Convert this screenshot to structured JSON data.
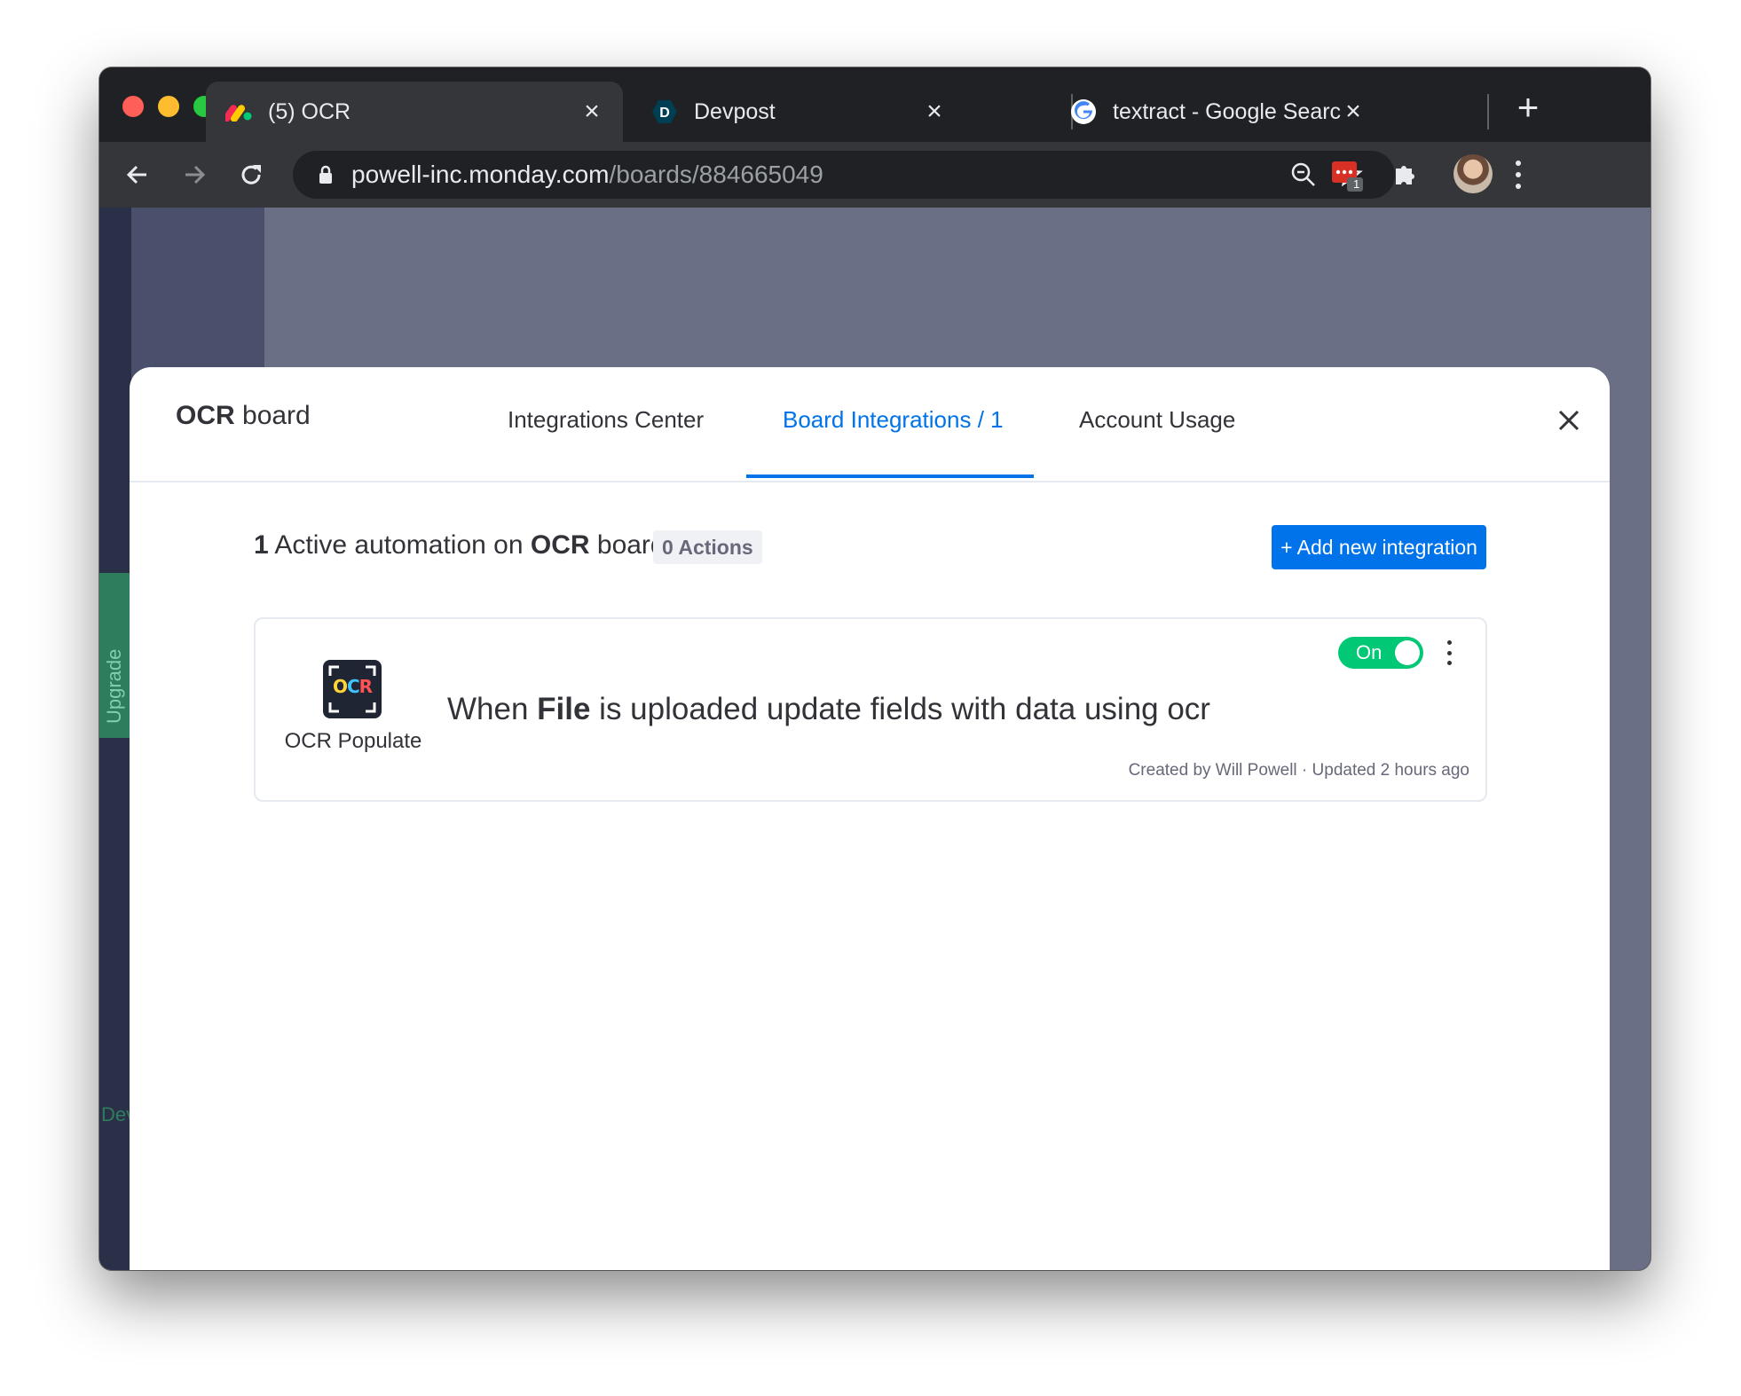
{
  "browser": {
    "tabs": [
      {
        "title": "(5) OCR",
        "icon": "monday-logo-icon",
        "active": true
      },
      {
        "title": "Devpost",
        "icon": "devpost-d-icon",
        "active": false
      },
      {
        "title": "textract - Google Search",
        "icon": "google-g-icon",
        "active": false
      }
    ],
    "url_host": "powell-inc.monday.com",
    "url_path": "/boards/884665049",
    "extension_badge": "1"
  },
  "background": {
    "sidebar_label": "Upgrade",
    "bottom_label": "Dev"
  },
  "modal": {
    "brand_bold": "OCR",
    "brand_rest": " board",
    "tabs": [
      {
        "label": "Integrations Center"
      },
      {
        "label": "Board Integrations / 1",
        "active": true
      },
      {
        "label": "Account Usage"
      }
    ],
    "summary": {
      "count": "1",
      "text_a": " Active automation on ",
      "board_name": "OCR",
      "text_b": " board"
    },
    "actions_badge": "0 Actions",
    "add_button": "+ Add new integration",
    "card": {
      "logo_text_o": "O",
      "logo_text_c": "C",
      "logo_text_r": "R",
      "app_name": "OCR Populate",
      "recipe_a": "When ",
      "recipe_bold": "File",
      "recipe_b": " is uploaded update fields with data using ocr",
      "toggle_label": "On",
      "toggle_on": true,
      "meta": "Created by Will Powell · Updated 2 hours ago"
    }
  },
  "colors": {
    "accent": "#0073ea",
    "toggle_on": "#00c875",
    "text": "#323338"
  }
}
